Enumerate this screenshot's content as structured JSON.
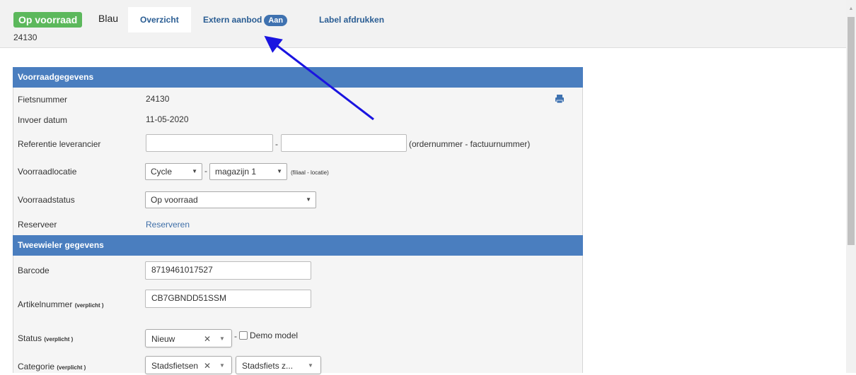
{
  "header": {
    "status_label": "Op voorraad",
    "color": "Blau",
    "bike_number": "24130",
    "tabs": [
      {
        "label": "Overzicht"
      },
      {
        "label": "Extern aanbod",
        "badge": "Aan"
      },
      {
        "label": "Label afdrukken"
      }
    ]
  },
  "stock_section": {
    "title": "Voorraadgegevens",
    "fietsnummer_label": "Fietsnummer",
    "fietsnummer_value": "24130",
    "invoer_label": "Invoer datum",
    "invoer_value": "11-05-2020",
    "referentie_label": "Referentie leverancier",
    "referentie_sep": "-",
    "referentie_hint": "(ordernummer - factuurnummer)",
    "locatie_label": "Voorraadlocatie",
    "locatie_branch": "Cycle",
    "locatie_sep": "-",
    "locatie_place": "magazijn 1",
    "locatie_hint": "(filiaal - locatie)",
    "status_label": "Voorraadstatus",
    "status_value": "Op voorraad",
    "reserveer_label": "Reserveer",
    "reserveer_link": "Reserveren"
  },
  "bike_section": {
    "title": "Tweewieler gegevens",
    "barcode_label": "Barcode",
    "barcode_value": "8719461017527",
    "artikel_label": "Artikelnummer",
    "artikel_required": "(verplicht )",
    "artikel_value": "CB7GBNDD51SSM",
    "status_label": "Status",
    "status_required": "(verplicht )",
    "status_value": "Nieuw",
    "status_sep": "-",
    "demo_label": "Demo model",
    "categorie_label": "Categorie",
    "categorie_required": "(verplicht )",
    "categorie_value": "Stadsfietsen",
    "subcategorie_value": "Stadsfiets z..."
  },
  "icons": {
    "printer": "printer-icon",
    "clear": "close-icon",
    "dropdown": "chevron-down-icon"
  },
  "colors": {
    "status_green": "#5cb85c",
    "section_blue": "#4a7ebf",
    "badge_blue": "#3f72b0",
    "annotation_arrow": "#1a14e0"
  }
}
